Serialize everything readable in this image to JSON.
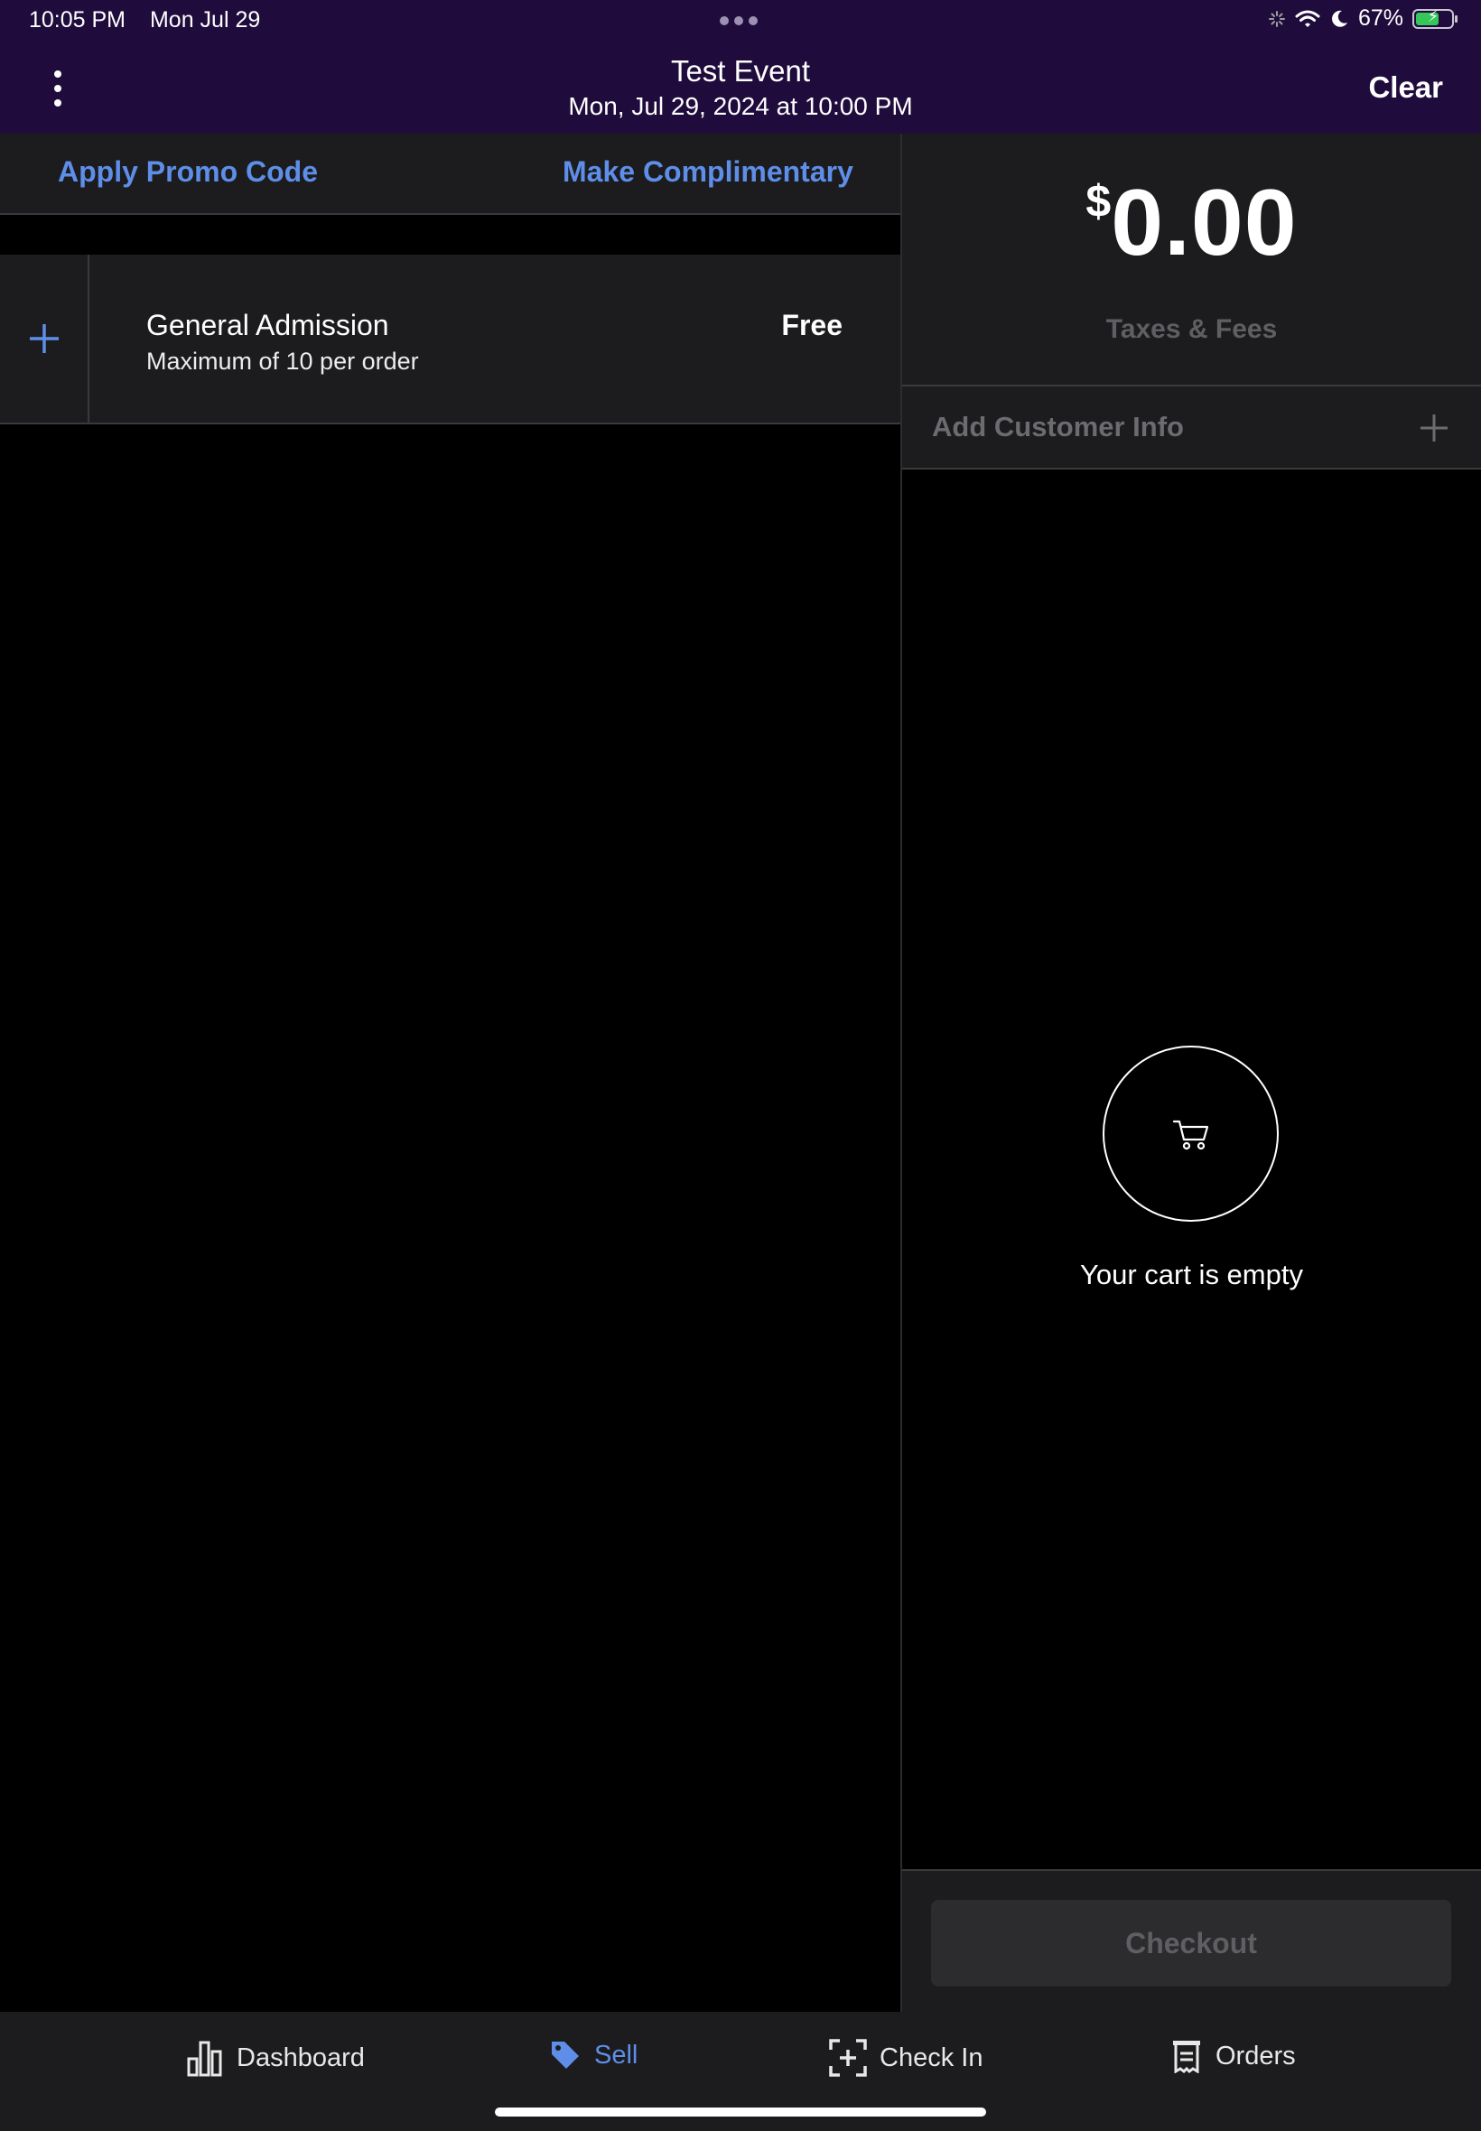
{
  "status_bar": {
    "time": "10:05 PM",
    "date": "Mon Jul 29",
    "battery_pct": "67%",
    "icons": [
      "activity-icon",
      "wifi-icon",
      "moon-icon",
      "battery-icon"
    ]
  },
  "header": {
    "title": "Test Event",
    "subtitle": "Mon, Jul 29, 2024 at 10:00 PM",
    "clear_label": "Clear"
  },
  "actions": {
    "promo_label": "Apply Promo Code",
    "comp_label": "Make Complimentary"
  },
  "tickets": [
    {
      "name": "General Admission",
      "note": "Maximum of 10 per order",
      "price": "Free"
    }
  ],
  "summary": {
    "currency": "$",
    "amount": "0.00",
    "taxes_label": "Taxes & Fees",
    "customer_label": "Add Customer Info",
    "empty_label": "Your cart is empty",
    "checkout_label": "Checkout"
  },
  "tabs": [
    {
      "label": "Dashboard",
      "icon": "bar-chart-icon",
      "active": false
    },
    {
      "label": "Sell",
      "icon": "tag-icon",
      "active": true
    },
    {
      "label": "Check In",
      "icon": "scan-icon",
      "active": false
    },
    {
      "label": "Orders",
      "icon": "receipt-icon",
      "active": false
    }
  ],
  "colors": {
    "header_bg": "#1f0c3c",
    "accent": "#5e8ee8",
    "panel_bg": "#1c1c1e",
    "muted_text": "#5f5f63"
  }
}
